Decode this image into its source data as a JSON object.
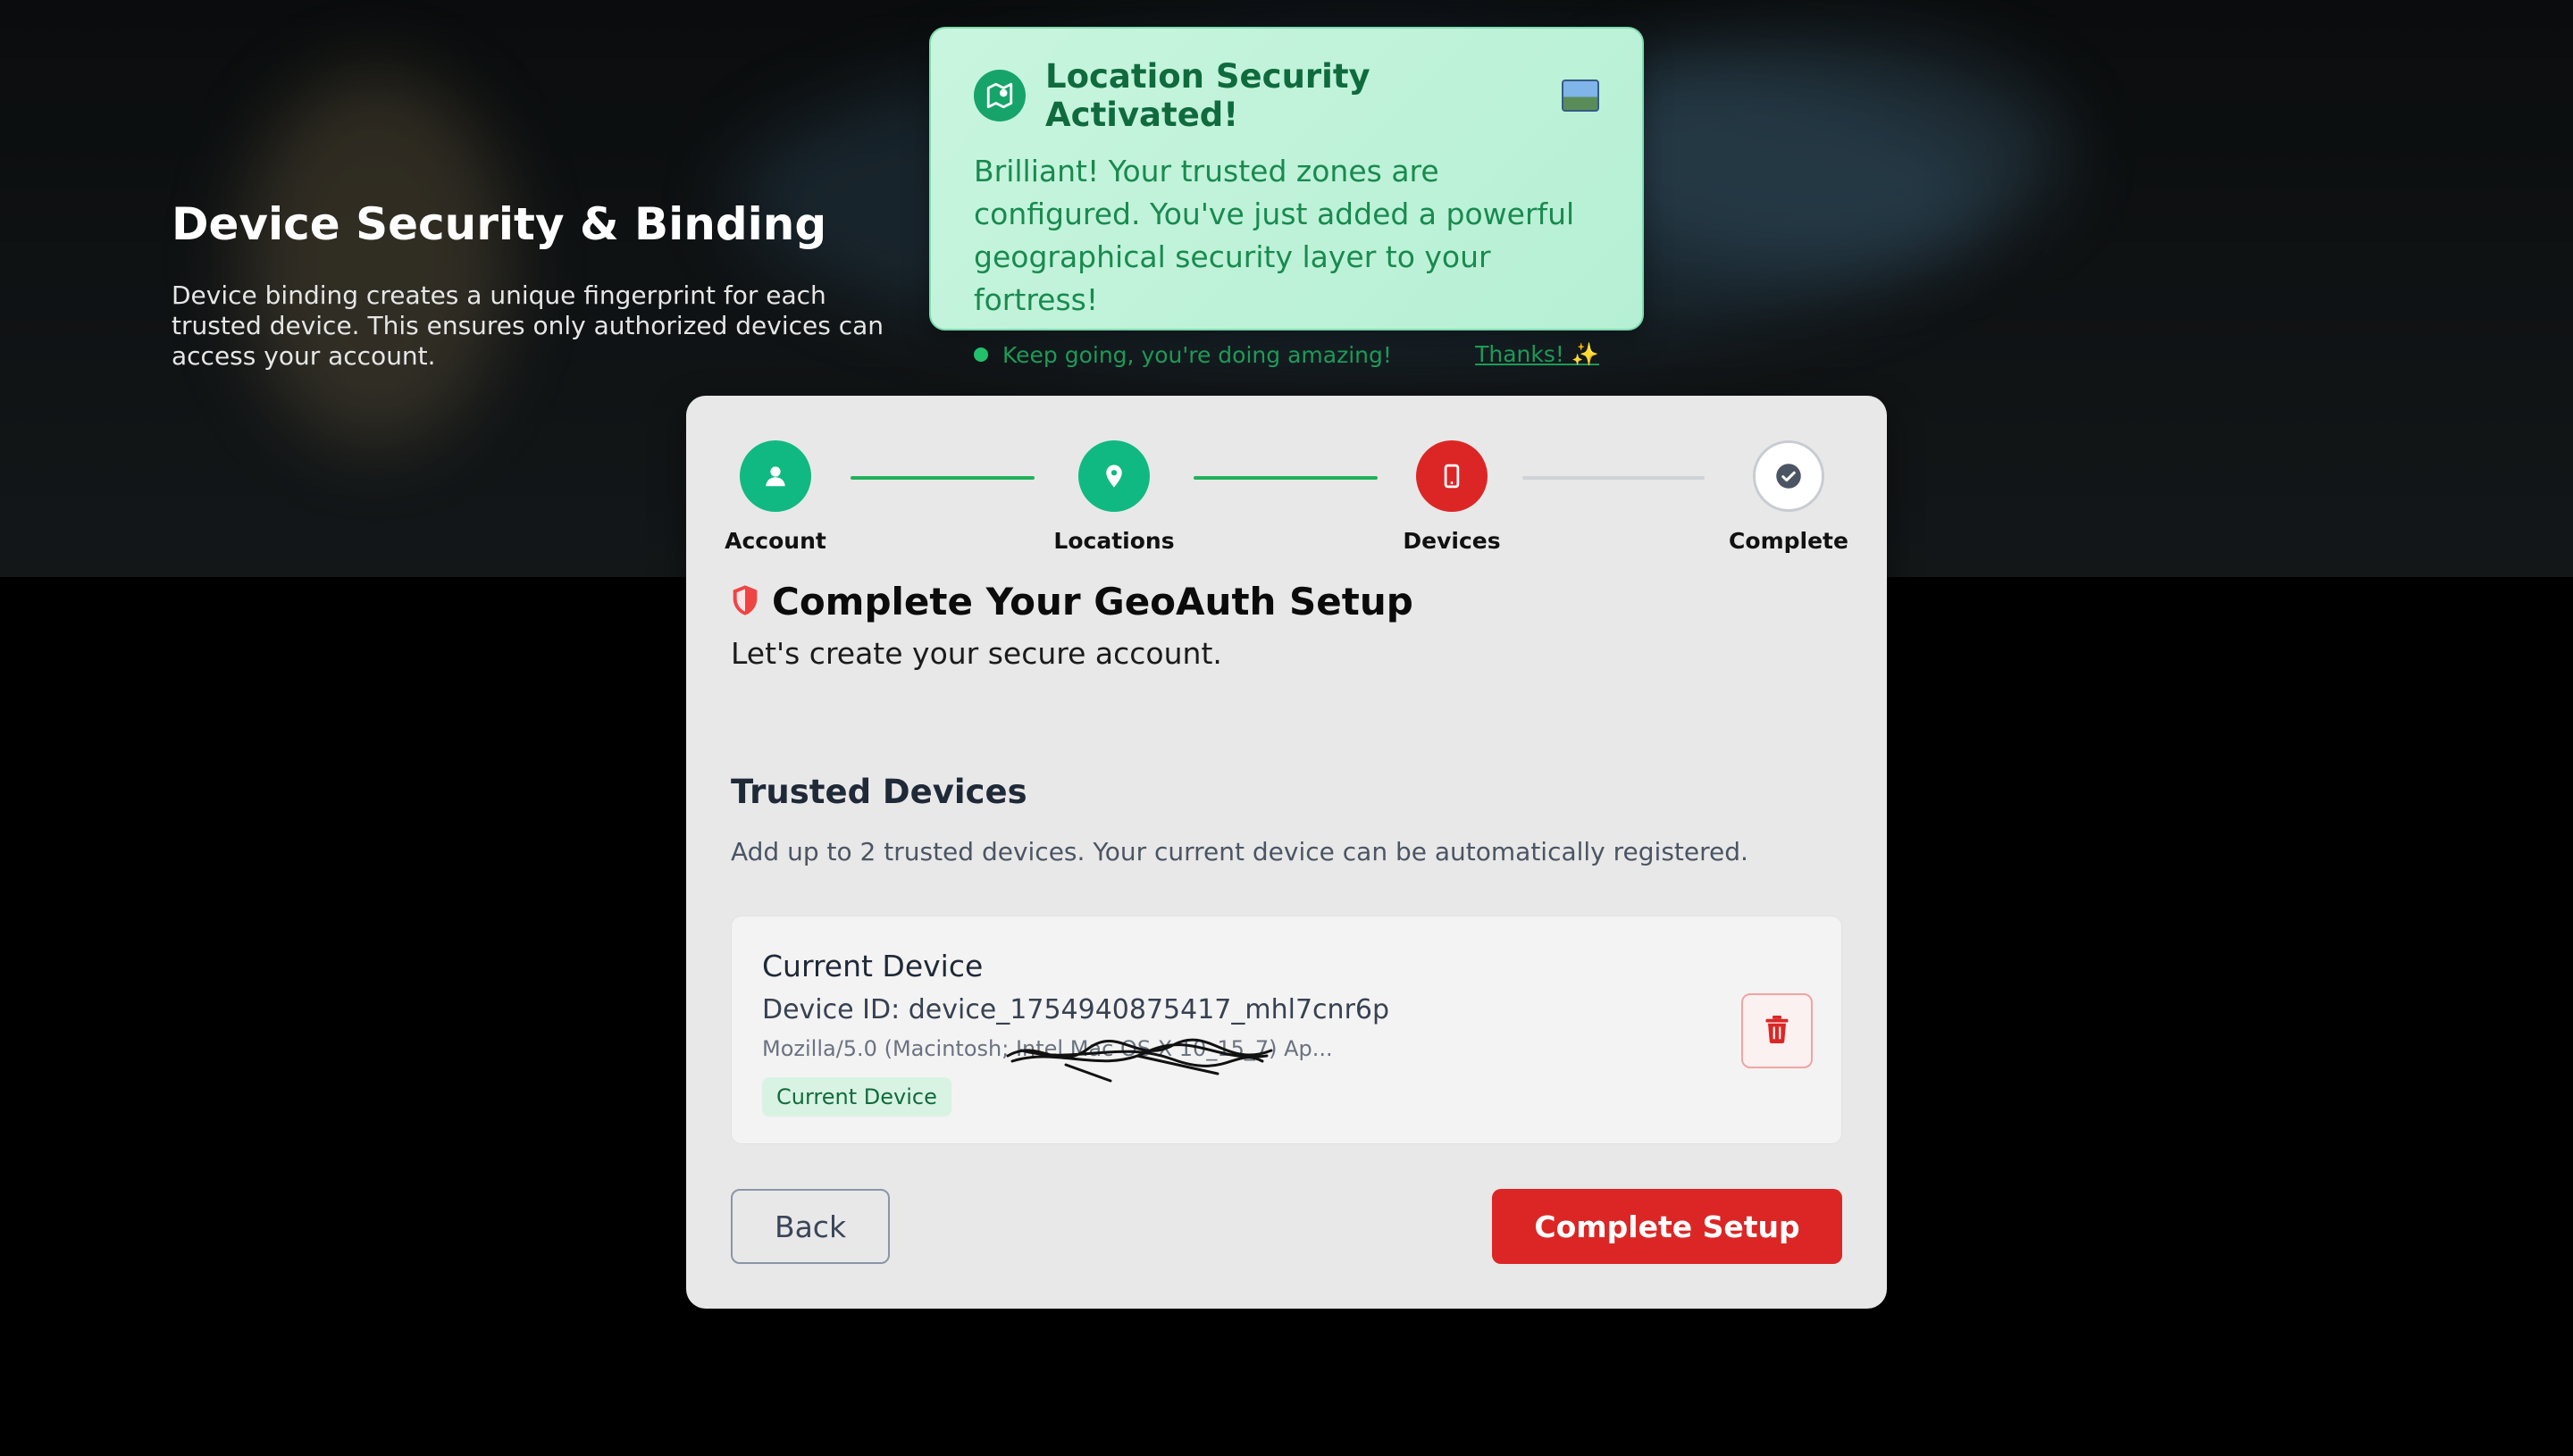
{
  "hero": {
    "title": "Device Security & Binding",
    "description": "Device binding creates a unique fingerprint for each trusted device. This ensures only authorized devices can access your account."
  },
  "toast": {
    "title": "Location Security Activated!",
    "emoji_icon": "landscape-photo-emoji",
    "body": "Brilliant! Your trusted zones are configured. You've just added a powerful geographical security layer to your fortress!",
    "hint": "Keep going, you're doing amazing!",
    "dismiss_label": "Thanks! ✨",
    "colors": {
      "background": "#c8f5de",
      "text": "#198a4f",
      "badge": "#16a46a"
    }
  },
  "stepper": {
    "steps": [
      {
        "label": "Account",
        "status": "done",
        "icon": "user-icon"
      },
      {
        "label": "Locations",
        "status": "done",
        "icon": "map-pin-icon"
      },
      {
        "label": "Devices",
        "status": "active",
        "icon": "smartphone-icon"
      },
      {
        "label": "Complete",
        "status": "pending",
        "icon": "check-circle-icon"
      }
    ],
    "colors": {
      "done": "#10b981",
      "active": "#dc2626",
      "pending_line": "#cfd2d6"
    }
  },
  "card": {
    "title": "Complete Your GeoAuth Setup",
    "subtitle": "Let's create your secure account."
  },
  "trusted_devices": {
    "title": "Trusted Devices",
    "description": "Add up to 2 trusted devices. Your current device can be automatically registered.",
    "devices": [
      {
        "name": "Current Device",
        "device_id": "Device ID: device_1754940875417_mhl7cnr6p",
        "user_agent": "Mozilla/5.0 (Macintosh; Intel Mac OS X 10_15_7) Ap...",
        "tag": "Current Device"
      }
    ]
  },
  "actions": {
    "back_label": "Back",
    "complete_label": "Complete Setup"
  }
}
